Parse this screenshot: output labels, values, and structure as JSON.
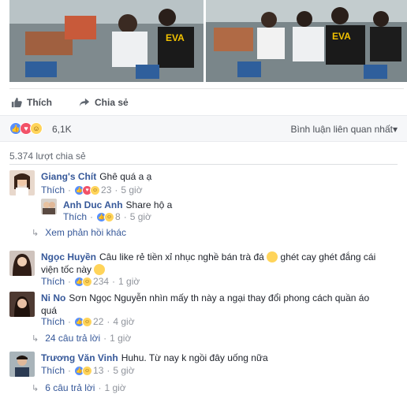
{
  "actions": {
    "like_label": "Thích",
    "share_label": "Chia sẻ"
  },
  "reactions": {
    "count": "6,1K",
    "sort": "Bình luận liên quan nhất▾"
  },
  "shares": "5.374 lượt chia sẻ",
  "comments": [
    {
      "author": "Giang's Chít",
      "text": "Ghê quá a ạ",
      "like": "Thích",
      "count": "23",
      "time": "5 giờ"
    },
    {
      "author": "Anh Duc Anh",
      "text": "Share hộ a",
      "like": "Thích",
      "count": "8",
      "time": "5 giờ"
    },
    {
      "author": "Ngọc Huyền",
      "text": "Câu like rẻ tiền xỉ nhục nghề bán trà đá",
      "text2": "ghét cay ghét đắng cái",
      "text3": "viện tốc này",
      "like": "Thích",
      "count": "234",
      "time": "1 giờ"
    },
    {
      "author": "Ni No",
      "text": "Sơn Ngọc Nguyễn nhìn mấy th này a ngại thay đổi phong cách quần áo",
      "text2": "quá",
      "like": "Thích",
      "count": "22",
      "time": "4 giờ"
    },
    {
      "author": "Trương Văn Vinh",
      "text": "Huhu. Từ nay k ngồi đây uống nữa",
      "like": "Thích",
      "count": "13",
      "time": "5 giờ"
    }
  ],
  "more_replies": "Xem phản hồi khác",
  "reply_links": [
    {
      "label": "24 câu trả lời",
      "time": "1 giờ"
    },
    {
      "label": "6 câu trả lời",
      "time": "1 giờ"
    }
  ],
  "photo_text": "EVA",
  "separator": "·",
  "colors": {
    "link": "#365899",
    "like": "#5890ff",
    "love": "#f25268",
    "haha": "#ffd45a",
    "meta": "#90949c"
  }
}
